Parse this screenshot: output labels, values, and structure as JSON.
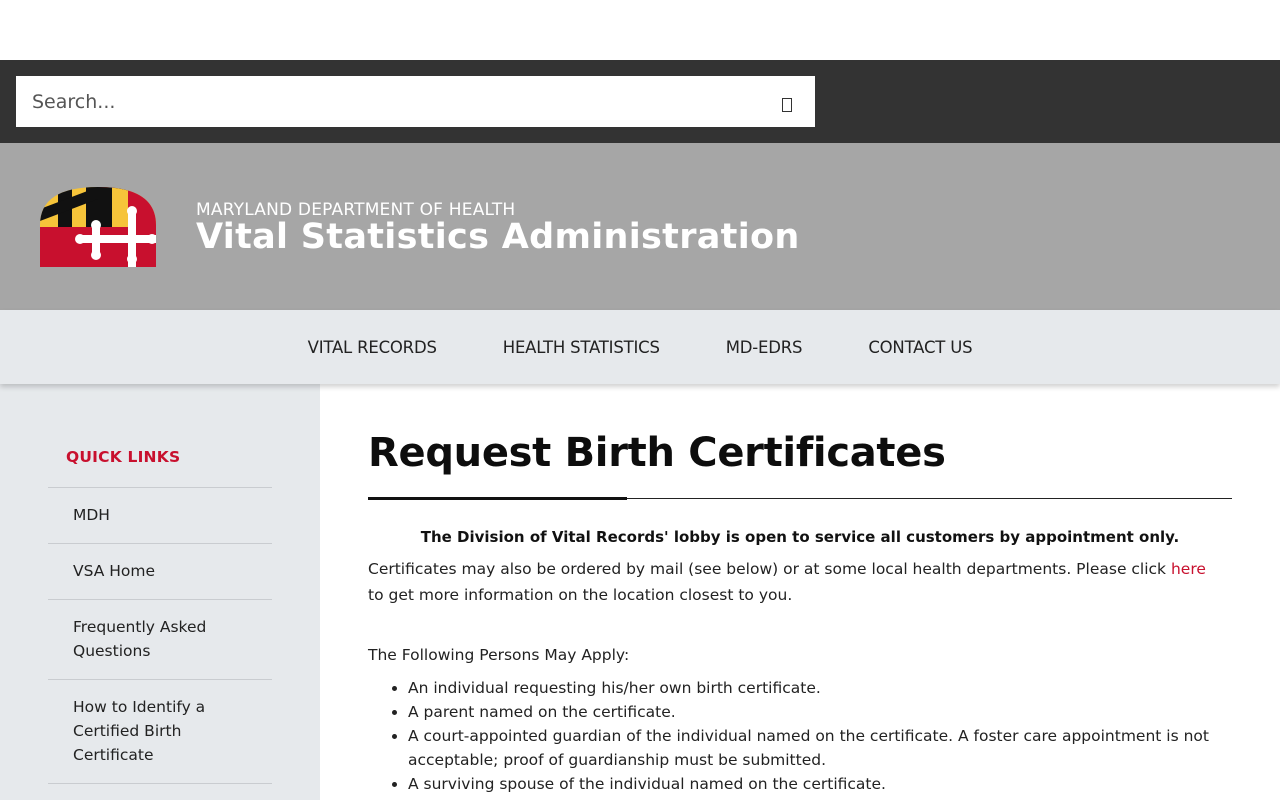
{
  "search": {
    "placeholder": "Search...",
    "button_icon": "search-icon"
  },
  "banner": {
    "department": "MARYLAND DEPARTMENT OF HEALTH",
    "agency": "Vital Statistics Administration",
    "logo": "maryland-flag-logo",
    "colors": {
      "red": "#c8102e",
      "gold": "#f6c43a",
      "black": "#111111",
      "white": "#ffffff"
    }
  },
  "nav": {
    "items": [
      {
        "label": "VITAL RECORDS"
      },
      {
        "label": "HEALTH STATISTICS"
      },
      {
        "label": "MD-EDRS"
      },
      {
        "label": "CONTACT US"
      }
    ]
  },
  "sidebar": {
    "title": "QUICK LINKS",
    "items": [
      {
        "label": "MDH"
      },
      {
        "label": "VSA Home"
      },
      {
        "label": "Frequently Asked Questions"
      },
      {
        "label": "How to Identify a Certified Birth Certificate"
      }
    ]
  },
  "main": {
    "title": "Request Birth Certificates",
    "notice": "The Division of Vital Records' lobby is open to service all customers by appointment only.",
    "para_before_link": "Certificates may also be ordered by mail (see below) or at some local health departments. Please click ",
    "link_text": "here",
    "para_after_link": " to get more information on the location closest to you.",
    "apply_heading": "The Following Persons May Apply:",
    "persons": [
      "An individual requesting his/her own birth certificate.",
      "A parent named on the certificate.",
      "A court-appointed guardian of the individual named on the certificate. A foster care appointment is not acceptable; proof of guardianship must be submitted.",
      "A surviving spouse of the individual named on the certificate."
    ]
  },
  "theme": {
    "accent": "#c8102e",
    "header_dark": "#333333",
    "banner_gray": "#a6a6a6",
    "nav_bg": "#e6e9ec"
  }
}
